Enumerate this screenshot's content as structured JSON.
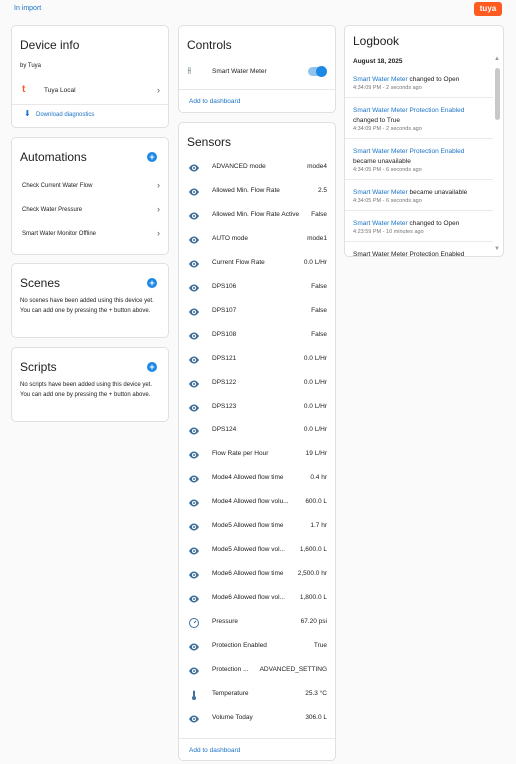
{
  "topbar": {
    "import_link": "In import",
    "brand": "tuya"
  },
  "device_info": {
    "title": "Device info",
    "by": "by Tuya",
    "integration": "Tuya Local",
    "download": "Download diagnostics"
  },
  "automations": {
    "title": "Automations",
    "items": [
      "Check Current Water Flow",
      "Check Water Pressure",
      "Smart Water Monitor Offline"
    ]
  },
  "scenes": {
    "title": "Scenes",
    "empty_text": "No scenes have been added using this device yet. You can add one by pressing the + button above."
  },
  "scripts": {
    "title": "Scripts",
    "empty_text": "No scripts have been added using this device yet. You can add one by pressing the + button above."
  },
  "controls": {
    "title": "Controls",
    "item_label": "Smart Water Meter",
    "toggle_on": true,
    "add_link": "Add to dashboard"
  },
  "sensors": {
    "title": "Sensors",
    "add_link": "Add to dashboard",
    "rows": [
      {
        "icon": "eye-icon",
        "label": "ADVANCED mode",
        "value": "mode4"
      },
      {
        "icon": "eye-icon",
        "label": "Allowed Min. Flow Rate",
        "value": "2.5"
      },
      {
        "icon": "eye-icon",
        "label": "Allowed Min. Flow Rate Active",
        "value": "False"
      },
      {
        "icon": "eye-icon",
        "label": "AUTO mode",
        "value": "mode1"
      },
      {
        "icon": "eye-icon",
        "label": "Current Flow Rate",
        "value": "0.0 L/Hr"
      },
      {
        "icon": "eye-icon",
        "label": "DPS106",
        "value": "False"
      },
      {
        "icon": "eye-icon",
        "label": "DPS107",
        "value": "False"
      },
      {
        "icon": "eye-icon",
        "label": "DPS108",
        "value": "False"
      },
      {
        "icon": "eye-icon",
        "label": "DPS121",
        "value": "0.0 L/Hr"
      },
      {
        "icon": "eye-icon",
        "label": "DPS122",
        "value": "0.0 L/Hr"
      },
      {
        "icon": "eye-icon",
        "label": "DPS123",
        "value": "0.0 L/Hr"
      },
      {
        "icon": "eye-icon",
        "label": "DPS124",
        "value": "0.0 L/Hr"
      },
      {
        "icon": "eye-icon",
        "label": "Flow Rate per Hour",
        "value": "19 L/Hr"
      },
      {
        "icon": "eye-icon",
        "label": "Mode4 Allowed flow time",
        "value": "0.4 hr"
      },
      {
        "icon": "eye-icon",
        "label": "Mode4 Allowed flow volu...",
        "value": "600.0 L"
      },
      {
        "icon": "eye-icon",
        "label": "Mode5 Allowed flow time",
        "value": "1.7 hr"
      },
      {
        "icon": "eye-icon",
        "label": "Mode5 Allowed flow vol...",
        "value": "1,600.0 L"
      },
      {
        "icon": "eye-icon",
        "label": "Mode6 Allowed flow time",
        "value": "2,500.0 hr"
      },
      {
        "icon": "eye-icon",
        "label": "Mode6 Allowed flow vol...",
        "value": "1,800.0 L"
      },
      {
        "icon": "gauge-icon",
        "label": "Pressure",
        "value": "67.20 psi"
      },
      {
        "icon": "eye-icon",
        "label": "Protection Enabled",
        "value": "True"
      },
      {
        "icon": "eye-icon",
        "label": "Protection ...",
        "value": "ADVANCED_SETTING"
      },
      {
        "icon": "thermometer-icon",
        "label": "Temperature",
        "value": "25.3 °C"
      },
      {
        "icon": "eye-icon",
        "label": "Volume Today",
        "value": "306.0 L"
      }
    ]
  },
  "logbook": {
    "title": "Logbook",
    "date": "August 18, 2025",
    "entries": [
      {
        "line1_link": "Smart Water Meter",
        "line1_rest": " changed to Open",
        "line2": "",
        "time": "4:34:09 PM - 2 seconds ago"
      },
      {
        "line1_link": "Smart Water Meter Protection Enabled",
        "line1_rest": "",
        "line2": "changed to True",
        "time": "4:34:09 PM - 2 seconds ago"
      },
      {
        "line1_link": "Smart Water Meter Protection Enabled",
        "line1_rest": "",
        "line2": "became unavailable",
        "time": "4:34:05 PM - 6 seconds ago"
      },
      {
        "line1_link": "Smart Water Meter",
        "line1_rest": " became unavailable",
        "line2": "",
        "time": "4:34:05 PM - 6 seconds ago"
      },
      {
        "line1_link": "Smart Water Meter",
        "line1_rest": " changed to Open",
        "line2": "",
        "time": "4:23:59 PM - 10 minutes ago"
      }
    ],
    "partial_entry": "Smart Water Meter Protection Enabled"
  }
}
